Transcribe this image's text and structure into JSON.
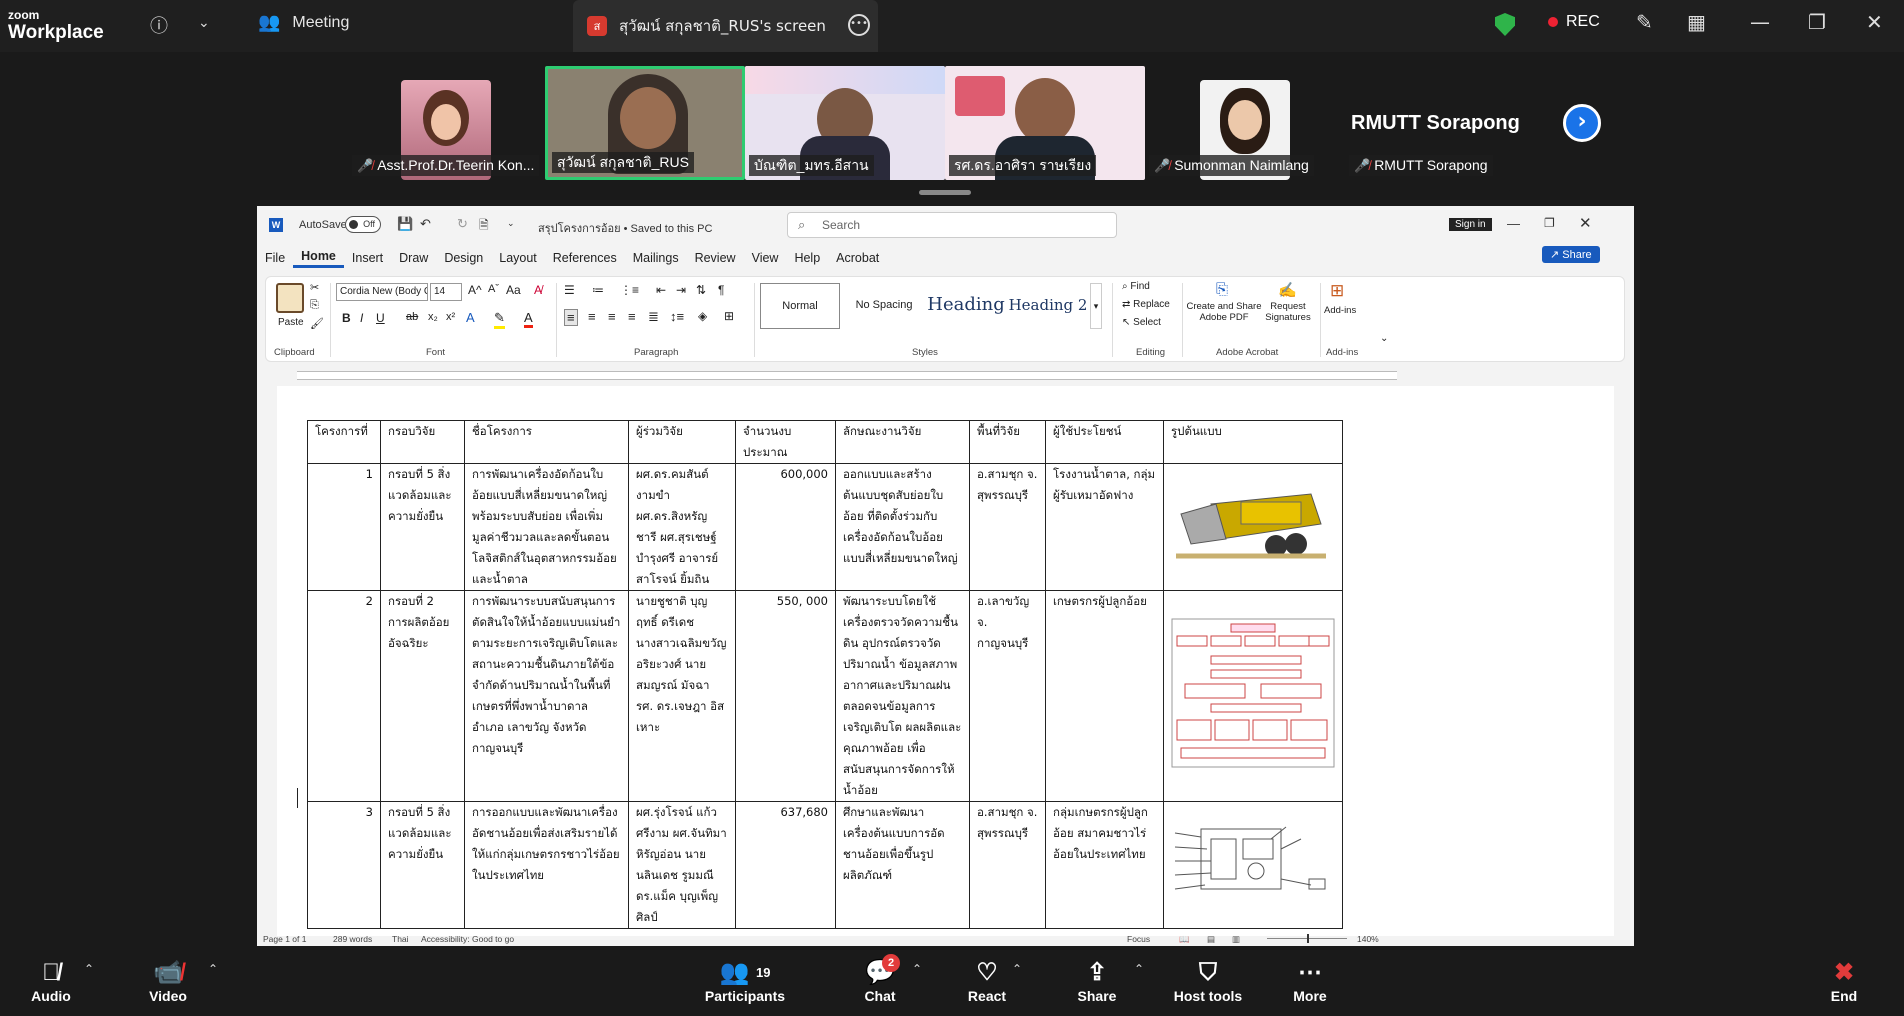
{
  "zoom": {
    "logo_top": "zoom",
    "logo_bottom": "Workplace",
    "meeting_label": "Meeting",
    "share_tab_label": "สุวัฒน์ สกุลชาติ_RUS's screen",
    "share_tab_initial": "ส",
    "rec_label": "REC"
  },
  "participants": [
    {
      "name": "Asst.Prof.Dr.Teerin Kon...",
      "muted": true
    },
    {
      "name": "สุวัฒน์ สกุลชาติ_RUS",
      "muted": false
    },
    {
      "name": "บัณฑิต_มทร.อีสาน",
      "muted": false
    },
    {
      "name": "รศ.ดร.อาศิรา ราษเรียง",
      "muted": false
    },
    {
      "name": "Sumonman Naimlang",
      "muted": true
    },
    {
      "name": "RMUTT Sorapong",
      "muted": true
    }
  ],
  "rmutt_name_big": "RMUTT Sorapong",
  "word": {
    "autosave": "AutoSave",
    "autosave_state": "Off",
    "doc_title": "สรุปโครงการอ้อย • Saved to this PC",
    "search_placeholder": "Search",
    "sign_in": "Sign in",
    "share": "Share",
    "menu": [
      "File",
      "Home",
      "Insert",
      "Draw",
      "Design",
      "Layout",
      "References",
      "Mailings",
      "Review",
      "View",
      "Help",
      "Acrobat"
    ],
    "font_name": "Cordia New (Body C",
    "font_size": "14",
    "paste": "Paste",
    "groups": [
      "Clipboard",
      "Font",
      "Paragraph",
      "Styles",
      "Editing",
      "Adobe Acrobat",
      "Add-ins"
    ],
    "styles": [
      "Normal",
      "No Spacing",
      "Heading",
      "Heading 2"
    ],
    "editing": [
      "Find",
      "Replace",
      "Select"
    ],
    "acrobat": [
      "Create and Share Adobe PDF",
      "Request Signatures"
    ],
    "addins": "Add-ins",
    "status": {
      "page": "Page 1 of 1",
      "words": "289 words",
      "lang": "Thai",
      "accessibility": "Accessibility: Good to go",
      "focus": "Focus",
      "zoom": "140%"
    }
  },
  "table": {
    "headers": [
      "โครงการที่",
      "กรอบวิจัย",
      "ชื่อโครงการ",
      "ผู้ร่วมวิจัย",
      "จำนวนงบประมาณ",
      "ลักษณะงานวิจัย",
      "พื้นที่วิจัย",
      "ผู้ใช้ประโยชน์",
      "รูปต้นแบบ"
    ],
    "rows": [
      {
        "no": "1",
        "frame": "กรอบที่ 5 สิ่งแวดล้อมและความยั่งยืน",
        "name": "การพัฒนาเครื่องอัดก้อนใบอ้อยแบบสี่เหลี่ยมขนาดใหญ่พร้อมระบบสับย่อย เพื่อเพิ่มมูลค่าชีวมวลและลดขั้นตอนโลจิสติกส์ในอุตสาหกรรมอ้อยและน้ำตาล",
        "team": "ผศ.ดร.คมสันต์ งามขำ ผศ.ดร.สิงหรัญ ชารี ผศ.สุรเชษฐ์ บำรุงศรี อาจารย์สาโรจน์ ยิ้มถิน",
        "budget": "600,000",
        "type": "ออกแบบและสร้างต้นแบบชุดสับย่อยใบอ้อย ที่ติดตั้งร่วมกับเครื่องอัดก้อนใบอ้อยแบบสี่เหลี่ยมขนาดใหญ่",
        "area": "อ.สามชุก จ. สุพรรณบุรี",
        "users": "โรงงานน้ำตาล, กลุ่มผู้รับเหมาอัดฟาง",
        "picture": "baler-machine"
      },
      {
        "no": "2",
        "frame": "กรอบที่ 2 การผลิตอ้อยอัจฉริยะ",
        "name": "การพัฒนาระบบสนับสนุนการตัดสินใจให้น้ำอ้อยแบบแม่นยำตามระยะการเจริญเติบโตและสถานะความชื้นดินภายใต้ข้อจำกัดด้านปริมาณน้ำในพื้นที่เกษตรที่พึ่งพาน้ำบาดาล อำเภอ เลาขวัญ จังหวัดกาญจนบุรี",
        "team": "นายชูชาติ บุญฤทธิ์ ดรีเดช นางสาวเฉลิมขวัญ อริยะวงศ์ นายสมญรณ์ มัจฉา รศ. ดร.เจษฎา อิสเหาะ",
        "budget": "550, 000",
        "type": "พัฒนาระบบโดยใช้เครื่องตรวจวัดความชื้นดิน อุปกรณ์ตรวจวัดปริมาณน้ำ ข้อมูลสภาพอากาศและปริมาณฝน ตลอดจนข้อมูลการเจริญเติบโต ผลผลิตและคุณภาพอ้อย เพื่อสนับสนุนการจัดการให้น้ำอ้อย",
        "area": "อ.เลาขวัญ จ. กาญจนบุรี",
        "users": "เกษตรกรผู้ปลูกอ้อย",
        "picture": "system-diagram"
      },
      {
        "no": "3",
        "frame": "กรอบที่ 5 สิ่งแวดล้อมและความยั่งยืน",
        "name": "การออกแบบและพัฒนาเครื่องอัดชานอ้อยเพื่อส่งเสริมรายได้ให้แก่กลุ่มเกษตรกรชาวไร่อ้อยในประเทศไทย",
        "team": "ผศ.รุ่งโรจน์ แก้วศรีงาม ผศ.จันทิมา หิรัญอ่อน นายนลินเดช รูมมณี ดร.แม็ค บุญเพ็ญศิลป์",
        "budget": "637,680",
        "type": "ศึกษาและพัฒนาเครื่องต้นแบบการอัดชานอ้อยเพื่อขึ้นรูปผลิตภัณฑ์",
        "area": "อ.สามชุก จ. สุพรรณบุรี",
        "users": "กลุ่มเกษตรกรผู้ปลูกอ้อย สมาคมชาวไร่อ้อยในประเทศไทย",
        "picture": "press-machine-drawing"
      }
    ]
  },
  "toolbar": {
    "audio": "Audio",
    "video": "Video",
    "participants": "Participants",
    "participants_count": "19",
    "chat": "Chat",
    "chat_badge": "2",
    "react": "React",
    "share": "Share",
    "host_tools": "Host tools",
    "more": "More",
    "end": "End"
  },
  "colors": {
    "active_speaker": "#2ecc71",
    "rec": "#ee2233",
    "security": "#2fb44a",
    "word_blue": "#185abd",
    "end": "#e23b3b"
  }
}
